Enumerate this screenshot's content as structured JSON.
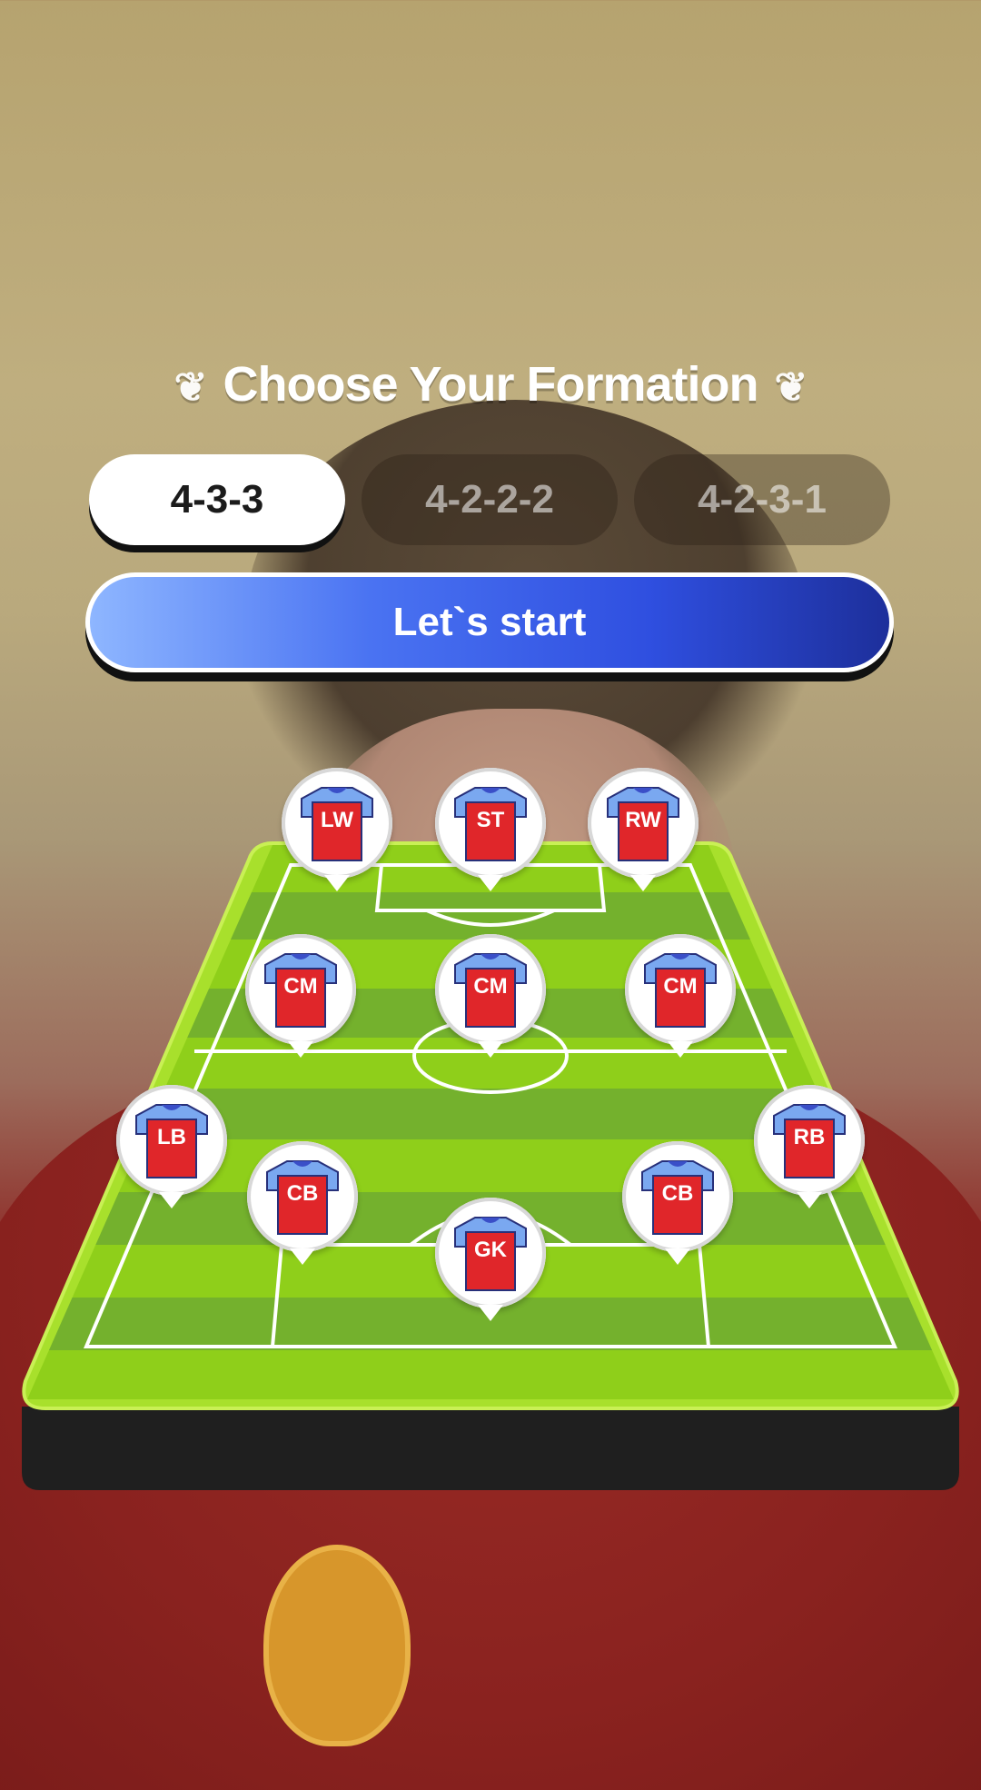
{
  "header": {
    "title": "Choose Your Formation",
    "laurel_icon": "laurel-icon"
  },
  "formations": [
    {
      "label": "4-3-3",
      "selected": true
    },
    {
      "label": "4-2-2-2",
      "selected": false
    },
    {
      "label": "4-2-3-1",
      "selected": false
    }
  ],
  "start_button": {
    "label": "Let`s start"
  },
  "pitch": {
    "colors": {
      "grass_light": "#9fd41a",
      "grass_dark": "#7ab52e",
      "lines": "#ffffff",
      "border": "#1f1f1f"
    },
    "players": [
      {
        "label": "LW"
      },
      {
        "label": "ST"
      },
      {
        "label": "RW"
      },
      {
        "label": "CM"
      },
      {
        "label": "CM"
      },
      {
        "label": "CM"
      },
      {
        "label": "LB"
      },
      {
        "label": "CB"
      },
      {
        "label": "CB"
      },
      {
        "label": "RB"
      },
      {
        "label": "GK"
      }
    ]
  },
  "colors": {
    "accent": "#2f4fe0",
    "jersey_body": "#e0262a",
    "jersey_sleeve": "#7aa8f0"
  }
}
